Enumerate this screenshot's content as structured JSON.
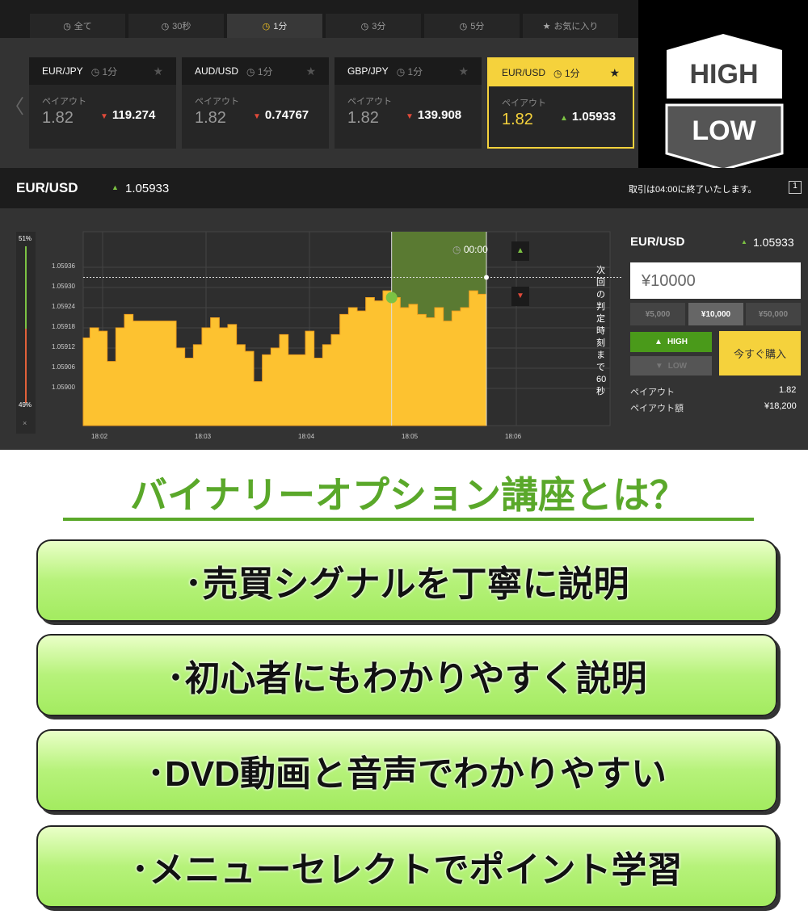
{
  "tabs": [
    {
      "label": "全て",
      "icon": "clock-icon"
    },
    {
      "label": "30秒",
      "icon": "clock-icon"
    },
    {
      "label": "1分",
      "icon": "clock-icon",
      "active": true
    },
    {
      "label": "3分",
      "icon": "clock-icon"
    },
    {
      "label": "5分",
      "icon": "clock-icon"
    },
    {
      "label": "お気に入り",
      "icon": "star-icon"
    }
  ],
  "cards": [
    {
      "pair": "EUR/JPY",
      "time": "1分",
      "payout_label": "ペイアウト",
      "payout": "1.82",
      "price": "119.274",
      "dir": "down"
    },
    {
      "pair": "AUD/USD",
      "time": "1分",
      "payout_label": "ペイアウト",
      "payout": "1.82",
      "price": "0.74767",
      "dir": "down"
    },
    {
      "pair": "GBP/JPY",
      "time": "1分",
      "payout_label": "ペイアウト",
      "payout": "1.82",
      "price": "139.908",
      "dir": "down"
    },
    {
      "pair": "EUR/USD",
      "time": "1分",
      "payout_label": "ペイアウト",
      "payout": "1.82",
      "price": "1.05933",
      "dir": "up",
      "selected": true
    }
  ],
  "logo": {
    "high": "HIGH",
    "low": "LOW"
  },
  "header": {
    "pair": "EUR/USD",
    "price": "1.05933",
    "notice": "取引は04:00に終了いたします。",
    "window_icon": "1"
  },
  "sentiment": {
    "high": "51%",
    "low": "49%",
    "high_pct": 51,
    "close": "×"
  },
  "chart": {
    "timer": "00:00",
    "side_note": "次回の判定時刻まで60秒",
    "y_ticks": [
      "1.05936",
      "1.05930",
      "1.05924",
      "1.05918",
      "1.05912",
      "1.05906",
      "1.05900"
    ],
    "x_ticks": [
      "18:02",
      "18:03",
      "18:04",
      "18:05",
      "18:06"
    ],
    "current": "1.05933",
    "entry_time": "18:04:50",
    "expiry_time": "18:05:45"
  },
  "chart_data": {
    "type": "area",
    "x": [
      "18:01:50",
      "18:01:55",
      "18:02:00",
      "18:02:05",
      "18:02:10",
      "18:02:15",
      "18:02:20",
      "18:02:35",
      "18:02:45",
      "18:02:50",
      "18:02:55",
      "18:03:00",
      "18:03:05",
      "18:03:10",
      "18:03:15",
      "18:03:20",
      "18:03:25",
      "18:03:30",
      "18:03:35",
      "18:03:40",
      "18:03:45",
      "18:03:50",
      "18:03:55",
      "18:04:00",
      "18:04:05",
      "18:04:10",
      "18:04:15",
      "18:04:20",
      "18:04:25",
      "18:04:30",
      "18:04:35",
      "18:04:40",
      "18:04:45",
      "18:04:50",
      "18:04:55",
      "18:05:00",
      "18:05:05",
      "18:05:10",
      "18:05:15",
      "18:05:20",
      "18:05:25",
      "18:05:30",
      "18:05:35",
      "18:05:40",
      "18:05:45"
    ],
    "values": [
      1.05915,
      1.05918,
      1.05917,
      1.05908,
      1.05918,
      1.05922,
      1.0592,
      1.0592,
      1.05912,
      1.05909,
      1.05913,
      1.05918,
      1.05921,
      1.05918,
      1.05919,
      1.05913,
      1.05911,
      1.05902,
      1.0591,
      1.05912,
      1.05916,
      1.0591,
      1.0591,
      1.05917,
      1.05909,
      1.05913,
      1.05916,
      1.05922,
      1.05924,
      1.05923,
      1.05927,
      1.05926,
      1.05929,
      1.05927,
      1.05924,
      1.05925,
      1.05922,
      1.05921,
      1.05924,
      1.0592,
      1.05923,
      1.05924,
      1.05929,
      1.05928,
      1.05933
    ],
    "ylim": [
      1.05892,
      1.05944
    ],
    "grid": true,
    "colors": {
      "fill": "#fdc230",
      "win_zone": "#5a7a32"
    }
  },
  "panel": {
    "pair": "EUR/USD",
    "price": "1.05933",
    "amount": "¥10000",
    "presets": [
      "¥5,000",
      "¥10,000",
      "¥50,000"
    ],
    "high": "HIGH",
    "low": "LOW",
    "buy": "今すぐ購入",
    "payout_label": "ペイアウト",
    "payout": "1.82",
    "payout_amount_label": "ペイアウト額",
    "payout_amount": "¥18,200"
  },
  "promo": {
    "title": "バイナリーオプション講座とは？",
    "items": [
      "･売買シグナルを丁寧に説明",
      "･初心者にもわかりやすく説明",
      "･DVD動画と音声でわかりやすい",
      "･メニューセレクトでポイント学習"
    ]
  }
}
